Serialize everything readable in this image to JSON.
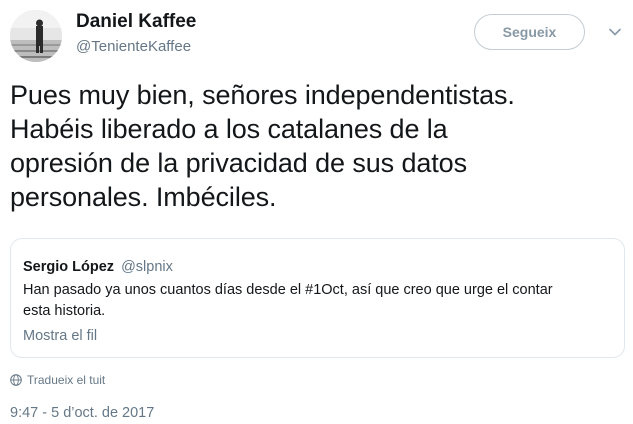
{
  "author": {
    "name": "Daniel Kaffee",
    "handle": "@TenienteKaffee"
  },
  "follow_button": {
    "label": "Segueix"
  },
  "tweet": {
    "lines": [
      "Pues muy bien, señores independentistas.",
      "Habéis liberado a los catalanes de la",
      "opresión de la privacidad de sus datos",
      "personales. Imbéciles."
    ]
  },
  "quoted_tweet": {
    "name": "Sergio López",
    "handle": "@slpnix",
    "lines": [
      "Han pasado ya unos cuantos días desde el #1Oct, así que creo que urge el contar",
      "esta historia."
    ],
    "thread_link": "Mostra el fil"
  },
  "translate": {
    "label": "Tradueix el tuit",
    "icon": "globe-icon"
  },
  "timestamp": "9:47 - 5 d’oct. de 2017",
  "colors": {
    "text": "#14171a",
    "secondary": "#657786",
    "border": "#e1e8ed"
  }
}
